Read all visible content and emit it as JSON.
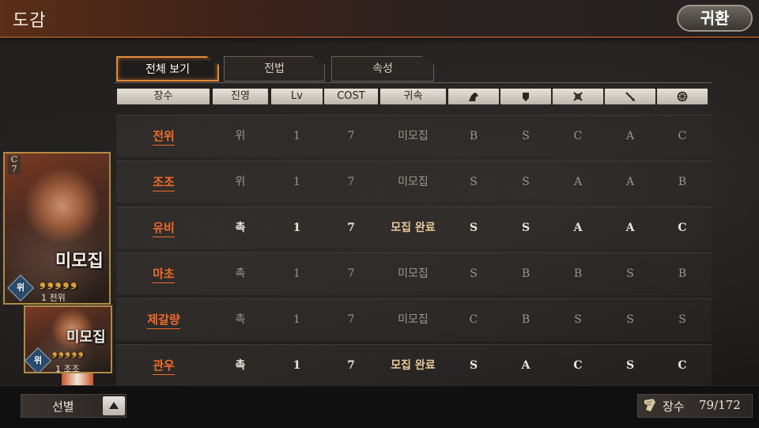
{
  "header": {
    "title": "도감",
    "back_label": "귀환"
  },
  "tabs": [
    {
      "label": "전체 보기",
      "active": true
    },
    {
      "label": "전법",
      "active": false
    },
    {
      "label": "속성",
      "active": false
    }
  ],
  "columns": {
    "name": "장수",
    "faction": "진영",
    "level": "Lv",
    "cost": "COST",
    "status": "귀속",
    "stat_icons": [
      "cavalry-icon",
      "shield-icon",
      "bow-icon",
      "spear-icon",
      "wheel-icon"
    ]
  },
  "rows": [
    {
      "name": "전위",
      "faction": "위",
      "level": "1",
      "cost": "7",
      "status": "미모집",
      "stats": [
        "B",
        "S",
        "C",
        "A",
        "C"
      ],
      "recruited": false
    },
    {
      "name": "조조",
      "faction": "위",
      "level": "1",
      "cost": "7",
      "status": "미모집",
      "stats": [
        "S",
        "S",
        "A",
        "A",
        "B"
      ],
      "recruited": false
    },
    {
      "name": "유비",
      "faction": "촉",
      "level": "1",
      "cost": "7",
      "status": "모집 완료",
      "stats": [
        "S",
        "S",
        "A",
        "A",
        "C"
      ],
      "recruited": true
    },
    {
      "name": "마초",
      "faction": "촉",
      "level": "1",
      "cost": "7",
      "status": "미모집",
      "stats": [
        "S",
        "B",
        "B",
        "S",
        "B"
      ],
      "recruited": false
    },
    {
      "name": "제갈량",
      "faction": "촉",
      "level": "1",
      "cost": "7",
      "status": "미모집",
      "stats": [
        "C",
        "B",
        "S",
        "S",
        "S"
      ],
      "recruited": false
    },
    {
      "name": "관우",
      "faction": "촉",
      "level": "1",
      "cost": "7",
      "status": "모집 완료",
      "stats": [
        "S",
        "A",
        "C",
        "S",
        "C"
      ],
      "recruited": true
    }
  ],
  "cards": [
    {
      "cost_label": "C",
      "cost": "7",
      "status": "미모집",
      "stars": "❟❟❟❟❟",
      "faction": "위",
      "level_name": "1 전위"
    },
    {
      "status": "미모집",
      "stars": "❟❟❟❟❟",
      "faction": "위",
      "level_name": "1 조조"
    }
  ],
  "footer": {
    "filter_label": "선별",
    "count_label": "장수",
    "count_value": "79/172"
  }
}
